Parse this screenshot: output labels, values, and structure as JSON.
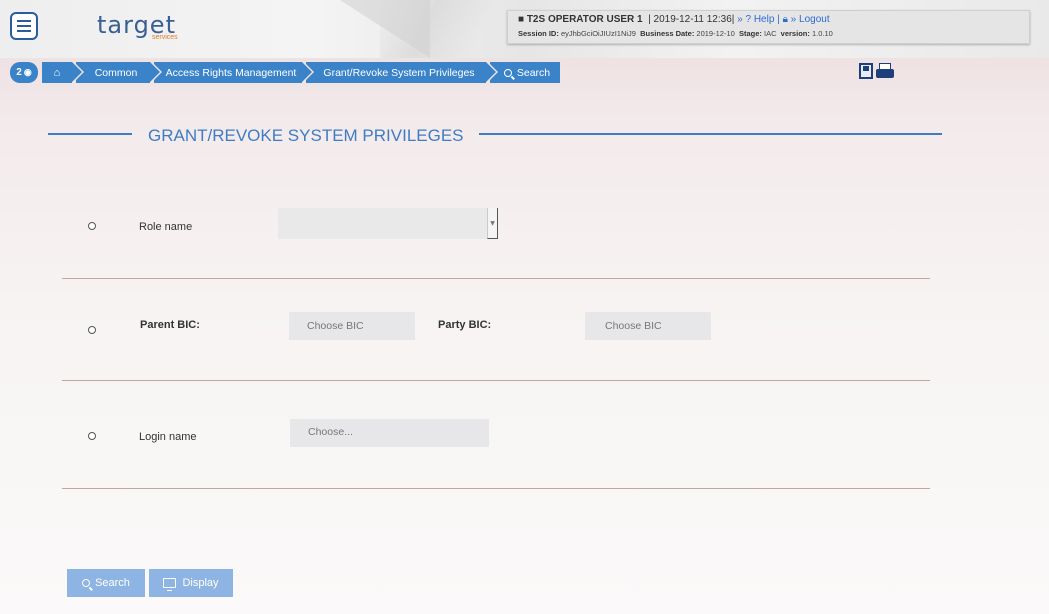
{
  "header": {
    "logo_text": "target",
    "logo_sub": "services",
    "user": "T2S OPERATOR USER 1",
    "datetime": "| 2019-12-11 12:36|",
    "help_label": "» ? Help",
    "sep": "|",
    "logout_label": "» Logout",
    "session_label": "Session ID:",
    "session_id": "eyJhbGciOiJIUzI1NiJ9",
    "business_date_label": "Business Date:",
    "business_date": "2019-12-10",
    "stage_label": "Stage:",
    "stage": "IAC",
    "version_label": "version:",
    "version": "1.0.10"
  },
  "breadcrumb": {
    "badge_count": "2",
    "items": [
      "Common",
      "Access Rights Management",
      "Grant/Revoke System Privileges",
      "Search"
    ]
  },
  "page": {
    "title": "GRANT/REVOKE SYSTEM PRIVILEGES"
  },
  "form": {
    "role_name_label": "Role name",
    "role_name_value": "",
    "parent_bic_label": "Parent BIC:",
    "parent_bic_placeholder": "Choose BIC",
    "party_bic_label": "Party BIC:",
    "party_bic_placeholder": "Choose BIC",
    "login_name_label": "Login name",
    "login_name_placeholder": "Choose..."
  },
  "actions": {
    "search_label": "Search",
    "display_label": "Display"
  },
  "icons": {
    "menu": "hamburger-icon",
    "user": "user-icon",
    "help": "question-icon",
    "logout": "lock-icon",
    "home": "home-icon",
    "search": "search-icon",
    "save": "save-icon",
    "print": "print-icon",
    "display": "monitor-icon"
  },
  "colors": {
    "accent": "#3b83c9",
    "title": "#3f7cc4",
    "button": "#8eb4e3"
  }
}
